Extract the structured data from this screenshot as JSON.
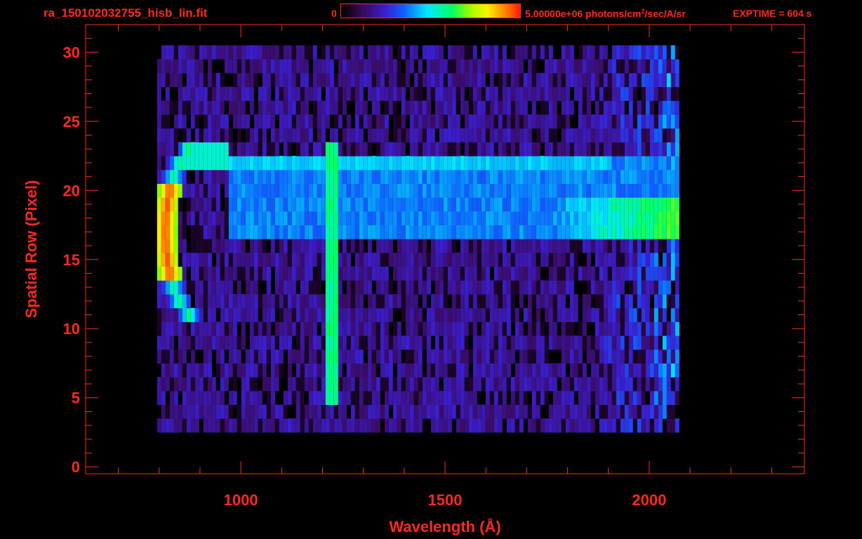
{
  "header": {
    "filename": "ra_150102032755_hisb_lin.fit",
    "colorbar_min": "0",
    "colorbar_max_prefix": "5.00000e+06 photons/cm",
    "colorbar_max_sup": "2",
    "colorbar_max_suffix": "/sec/A/sr",
    "exptime": "EXPTIME = 604 s"
  },
  "colors": {
    "axis": "#ff2a1a",
    "background": "#000000",
    "colormap": [
      "#000000",
      "#3a0a5a",
      "#3b1fd0",
      "#1060ff",
      "#00e8ff",
      "#00ff60",
      "#a0ff00",
      "#ffee00",
      "#ff8000",
      "#ff1a00"
    ]
  },
  "chart_data": {
    "type": "heatmap",
    "title": "ra_150102032755_hisb_lin.fit",
    "xlabel": "Wavelength (Å)",
    "ylabel": "Spatial Row (Pixel)",
    "xlim": [
      620,
      2380
    ],
    "ylim": [
      -0.5,
      32
    ],
    "x_ticks": [
      1000,
      1500,
      2000
    ],
    "y_ticks": [
      0,
      5,
      10,
      15,
      20,
      25,
      30
    ],
    "colorbar": {
      "min": 0,
      "max": 5000000,
      "units": "photons/cm^2/sec/A/sr"
    },
    "grid": false,
    "data_extent": {
      "x": [
        795,
        2070
      ],
      "y_rows": [
        3,
        30
      ]
    },
    "features": [
      {
        "name": "lyman-alpha-line",
        "x": 1216,
        "rows": [
          5,
          23
        ],
        "peak_fraction": 0.55
      },
      {
        "name": "arc-bright-feature",
        "x": [
          790,
          960
        ],
        "rows": [
          11,
          23
        ],
        "peak_fraction": 0.95
      },
      {
        "name": "horizontal-band",
        "x": [
          960,
          2070
        ],
        "rows": [
          17,
          22
        ],
        "peak_fraction": 0.45
      }
    ]
  }
}
